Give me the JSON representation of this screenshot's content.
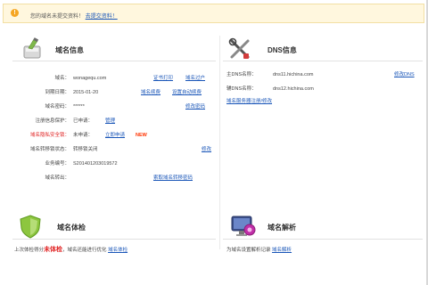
{
  "notice": {
    "text": "您的域名未提交资料！",
    "link": "去提交资料！"
  },
  "domain_info": {
    "title": "域名信息",
    "rows": [
      {
        "label": "域名：",
        "value": "wonagequ.com",
        "actions": [
          "证书打印",
          "域名过户"
        ]
      },
      {
        "label": "到期日期：",
        "value": "2015-01-20",
        "actions": [
          "域名续费",
          "设置自动续费"
        ]
      },
      {
        "label": "域名密码：",
        "value": "******",
        "actions": [
          "修改密码"
        ]
      },
      {
        "label": "注册信息保护：",
        "value": "已申请：",
        "actions": [
          "管理"
        ]
      },
      {
        "label": "域名隐私安全锁：",
        "value": "未申请：",
        "actions": [
          "立即申请"
        ],
        "badge": "NEW"
      },
      {
        "label": "域名转移锁状态：",
        "value": "转移锁关闭",
        "actions": [
          "修改"
        ]
      },
      {
        "label": "业务编号：",
        "value": "S20140120301957​2",
        "actions": []
      },
      {
        "label": "域名转出：",
        "value": "",
        "actions": [
          "索取域名转移密码"
        ]
      }
    ]
  },
  "dns_info": {
    "title": "DNS信息",
    "rows": [
      {
        "label": "主DNS名称：",
        "value": "dns11.hichina.com",
        "action": "修改DNS"
      },
      {
        "label": "辅DNS名称：",
        "value": "dns12.hichina.com",
        "action": ""
      }
    ],
    "extra_link": "域名服务器注册/修改"
  },
  "domain_check": {
    "title": "域名体检",
    "text_before": "上次体检得分",
    "score_text": "未体检",
    "text_after": "，域名还能进行优化",
    "link": "域名体检"
  },
  "dns_resolve": {
    "title": "域名解析",
    "text": "为域名设置解析记录",
    "link": "域名解析"
  }
}
